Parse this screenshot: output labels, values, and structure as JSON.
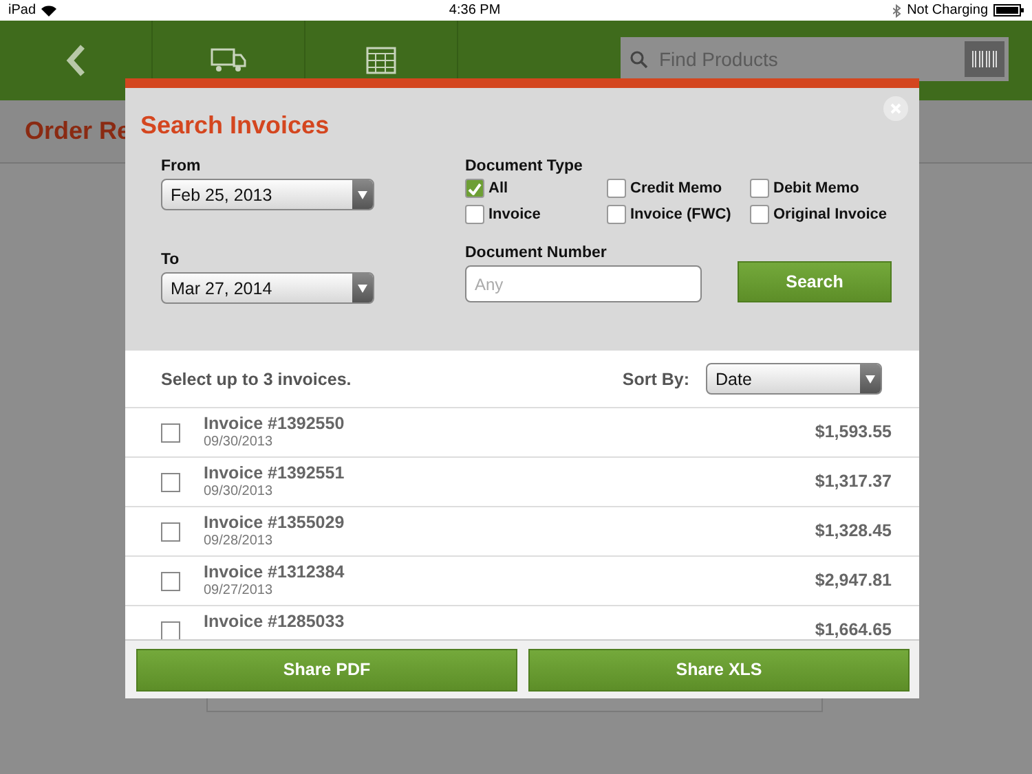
{
  "status_bar": {
    "device": "iPad",
    "time": "4:36 PM",
    "battery_text": "Not Charging"
  },
  "nav": {
    "search": {
      "placeholder": "Find Products"
    }
  },
  "page": {
    "title": "Order Re"
  },
  "dialog": {
    "title": "Search Invoices",
    "from": {
      "label": "From",
      "value": "Feb 25, 2013"
    },
    "to": {
      "label": "To",
      "value": "Mar 27, 2014"
    },
    "document_type": {
      "label": "Document Type",
      "options": [
        {
          "label": "All",
          "checked": true
        },
        {
          "label": "Credit Memo",
          "checked": false
        },
        {
          "label": "Debit Memo",
          "checked": false
        },
        {
          "label": "Invoice",
          "checked": false
        },
        {
          "label": "Invoice (FWC)",
          "checked": false
        },
        {
          "label": "Original Invoice",
          "checked": false
        }
      ]
    },
    "document_number": {
      "label": "Document Number",
      "placeholder": "Any"
    },
    "search_button": "Search",
    "hint": "Select up to 3 invoices.",
    "sort": {
      "label": "Sort By:",
      "value": "Date"
    },
    "invoices": [
      {
        "name": "Invoice #1392550",
        "date": "09/30/2013",
        "amount": "$1,593.55",
        "checked": false
      },
      {
        "name": "Invoice #1392551",
        "date": "09/30/2013",
        "amount": "$1,317.37",
        "checked": false
      },
      {
        "name": "Invoice #1355029",
        "date": "09/28/2013",
        "amount": "$1,328.45",
        "checked": false
      },
      {
        "name": "Invoice #1312384",
        "date": "09/27/2013",
        "amount": "$2,947.81",
        "checked": false
      },
      {
        "name": "Invoice #1285033",
        "amount": "$1,664.65",
        "checked": false
      }
    ],
    "buttons": [
      "Share PDF",
      "Share XLS"
    ]
  }
}
